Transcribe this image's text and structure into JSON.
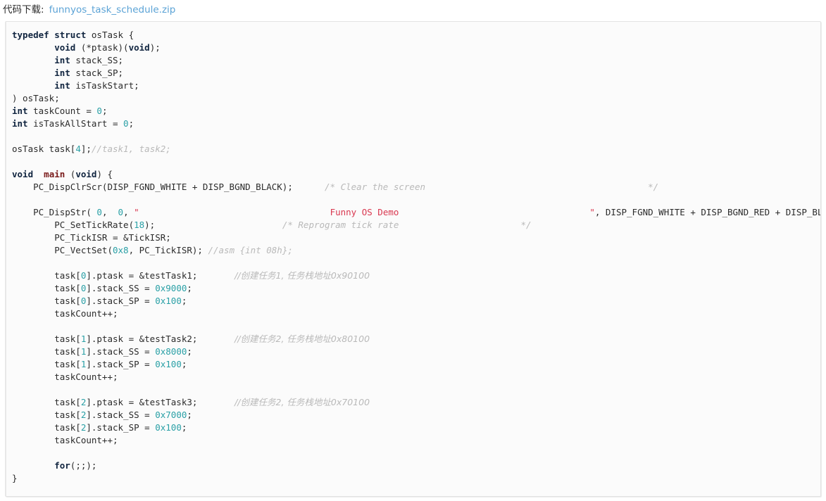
{
  "header": {
    "label": "代码下载:",
    "link_text": "funnyos_task_schedule.zip",
    "link_color": "#5ba3d6"
  },
  "colors": {
    "page_background": "#ffffff",
    "code_background": "#fbfbfb",
    "code_border": "#e3e3e3",
    "keyword": "#10243f",
    "function_name": "#7a1b1b",
    "number": "#2aa0a6",
    "string": "#d9374f",
    "comment": "#b9b9b9",
    "text": "#2b2b2b"
  },
  "code": {
    "language": "c",
    "lines": [
      {
        "tokens": [
          {
            "t": "typedef",
            "c": "kw"
          },
          {
            "t": " ",
            "c": "plain"
          },
          {
            "t": "struct",
            "c": "kw"
          },
          {
            "t": " osTask {",
            "c": "plain"
          }
        ]
      },
      {
        "tokens": [
          {
            "t": "        ",
            "c": "plain"
          },
          {
            "t": "void",
            "c": "kw"
          },
          {
            "t": " (*ptask)(",
            "c": "plain"
          },
          {
            "t": "void",
            "c": "kw"
          },
          {
            "t": ");",
            "c": "plain"
          }
        ]
      },
      {
        "tokens": [
          {
            "t": "        ",
            "c": "plain"
          },
          {
            "t": "int",
            "c": "kw"
          },
          {
            "t": " stack_SS;",
            "c": "plain"
          }
        ]
      },
      {
        "tokens": [
          {
            "t": "        ",
            "c": "plain"
          },
          {
            "t": "int",
            "c": "kw"
          },
          {
            "t": " stack_SP;",
            "c": "plain"
          }
        ]
      },
      {
        "tokens": [
          {
            "t": "        ",
            "c": "plain"
          },
          {
            "t": "int",
            "c": "kw"
          },
          {
            "t": " isTaskStart;",
            "c": "plain"
          }
        ]
      },
      {
        "tokens": [
          {
            "t": ") osTask;",
            "c": "plain"
          }
        ]
      },
      {
        "tokens": [
          {
            "t": "int",
            "c": "kw"
          },
          {
            "t": " taskCount = ",
            "c": "plain"
          },
          {
            "t": "0",
            "c": "num"
          },
          {
            "t": ";",
            "c": "plain"
          }
        ]
      },
      {
        "tokens": [
          {
            "t": "int",
            "c": "kw"
          },
          {
            "t": " isTaskAllStart = ",
            "c": "plain"
          },
          {
            "t": "0",
            "c": "num"
          },
          {
            "t": ";",
            "c": "plain"
          }
        ]
      },
      {
        "tokens": []
      },
      {
        "tokens": [
          {
            "t": "osTask task[",
            "c": "plain"
          },
          {
            "t": "4",
            "c": "num"
          },
          {
            "t": "];",
            "c": "plain"
          },
          {
            "t": "//task1, task2;",
            "c": "cmt"
          }
        ]
      },
      {
        "tokens": []
      },
      {
        "tokens": [
          {
            "t": "void",
            "c": "kw"
          },
          {
            "t": "  ",
            "c": "plain"
          },
          {
            "t": "main",
            "c": "fn"
          },
          {
            "t": " (",
            "c": "plain"
          },
          {
            "t": "void",
            "c": "kw"
          },
          {
            "t": ") {",
            "c": "plain"
          }
        ]
      },
      {
        "tokens": [
          {
            "t": "    PC_DispClrScr(DISP_FGND_WHITE + DISP_BGND_BLACK);      ",
            "c": "plain"
          },
          {
            "t": "/* Clear the screen                                          */",
            "c": "cmt"
          }
        ]
      },
      {
        "tokens": []
      },
      {
        "tokens": [
          {
            "t": "    PC_DispStr( ",
            "c": "plain"
          },
          {
            "t": "0",
            "c": "num"
          },
          {
            "t": ",  ",
            "c": "plain"
          },
          {
            "t": "0",
            "c": "num"
          },
          {
            "t": ", ",
            "c": "plain"
          },
          {
            "t": "\"                                    Funny OS Demo                                    \"",
            "c": "str"
          },
          {
            "t": ", DISP_FGND_WHITE + DISP_BGND_RED + DISP_BLINK);",
            "c": "plain"
          }
        ]
      },
      {
        "tokens": [
          {
            "t": "        PC_SetTickRate(",
            "c": "plain"
          },
          {
            "t": "18",
            "c": "num"
          },
          {
            "t": ");                        ",
            "c": "plain"
          },
          {
            "t": "/* Reprogram tick rate                       */",
            "c": "cmt"
          }
        ]
      },
      {
        "tokens": [
          {
            "t": "        PC_TickISR = &TickISR;",
            "c": "plain"
          }
        ]
      },
      {
        "tokens": [
          {
            "t": "        PC_VectSet(",
            "c": "plain"
          },
          {
            "t": "0x8",
            "c": "num"
          },
          {
            "t": ", PC_TickISR); ",
            "c": "plain"
          },
          {
            "t": "//asm {int 08h};",
            "c": "cmt"
          }
        ]
      },
      {
        "tokens": []
      },
      {
        "tokens": [
          {
            "t": "        task[",
            "c": "plain"
          },
          {
            "t": "0",
            "c": "num"
          },
          {
            "t": "].ptask = &testTask1;       ",
            "c": "plain"
          },
          {
            "t": "//创建任务1, 任务栈地址0x90100",
            "c": "cmt-cn"
          }
        ]
      },
      {
        "tokens": [
          {
            "t": "        task[",
            "c": "plain"
          },
          {
            "t": "0",
            "c": "num"
          },
          {
            "t": "].stack_SS = ",
            "c": "plain"
          },
          {
            "t": "0x9000",
            "c": "num"
          },
          {
            "t": ";",
            "c": "plain"
          }
        ]
      },
      {
        "tokens": [
          {
            "t": "        task[",
            "c": "plain"
          },
          {
            "t": "0",
            "c": "num"
          },
          {
            "t": "].stack_SP = ",
            "c": "plain"
          },
          {
            "t": "0x100",
            "c": "num"
          },
          {
            "t": ";",
            "c": "plain"
          }
        ]
      },
      {
        "tokens": [
          {
            "t": "        taskCount++;",
            "c": "plain"
          }
        ]
      },
      {
        "tokens": []
      },
      {
        "tokens": [
          {
            "t": "        task[",
            "c": "plain"
          },
          {
            "t": "1",
            "c": "num"
          },
          {
            "t": "].ptask = &testTask2;       ",
            "c": "plain"
          },
          {
            "t": "//创建任务2, 任务栈地址0x80100",
            "c": "cmt-cn"
          }
        ]
      },
      {
        "tokens": [
          {
            "t": "        task[",
            "c": "plain"
          },
          {
            "t": "1",
            "c": "num"
          },
          {
            "t": "].stack_SS = ",
            "c": "plain"
          },
          {
            "t": "0x8000",
            "c": "num"
          },
          {
            "t": ";",
            "c": "plain"
          }
        ]
      },
      {
        "tokens": [
          {
            "t": "        task[",
            "c": "plain"
          },
          {
            "t": "1",
            "c": "num"
          },
          {
            "t": "].stack_SP = ",
            "c": "plain"
          },
          {
            "t": "0x100",
            "c": "num"
          },
          {
            "t": ";",
            "c": "plain"
          }
        ]
      },
      {
        "tokens": [
          {
            "t": "        taskCount++;",
            "c": "plain"
          }
        ]
      },
      {
        "tokens": []
      },
      {
        "tokens": [
          {
            "t": "        task[",
            "c": "plain"
          },
          {
            "t": "2",
            "c": "num"
          },
          {
            "t": "].ptask = &testTask3;       ",
            "c": "plain"
          },
          {
            "t": "//创建任务2, 任务栈地址0x70100",
            "c": "cmt-cn"
          }
        ]
      },
      {
        "tokens": [
          {
            "t": "        task[",
            "c": "plain"
          },
          {
            "t": "2",
            "c": "num"
          },
          {
            "t": "].stack_SS = ",
            "c": "plain"
          },
          {
            "t": "0x7000",
            "c": "num"
          },
          {
            "t": ";",
            "c": "plain"
          }
        ]
      },
      {
        "tokens": [
          {
            "t": "        task[",
            "c": "plain"
          },
          {
            "t": "2",
            "c": "num"
          },
          {
            "t": "].stack_SP = ",
            "c": "plain"
          },
          {
            "t": "0x100",
            "c": "num"
          },
          {
            "t": ";",
            "c": "plain"
          }
        ]
      },
      {
        "tokens": [
          {
            "t": "        taskCount++;",
            "c": "plain"
          }
        ]
      },
      {
        "tokens": []
      },
      {
        "tokens": [
          {
            "t": "        ",
            "c": "plain"
          },
          {
            "t": "for",
            "c": "kw"
          },
          {
            "t": "(;;);",
            "c": "plain"
          }
        ]
      },
      {
        "tokens": [
          {
            "t": "}",
            "c": "plain"
          }
        ]
      }
    ]
  }
}
